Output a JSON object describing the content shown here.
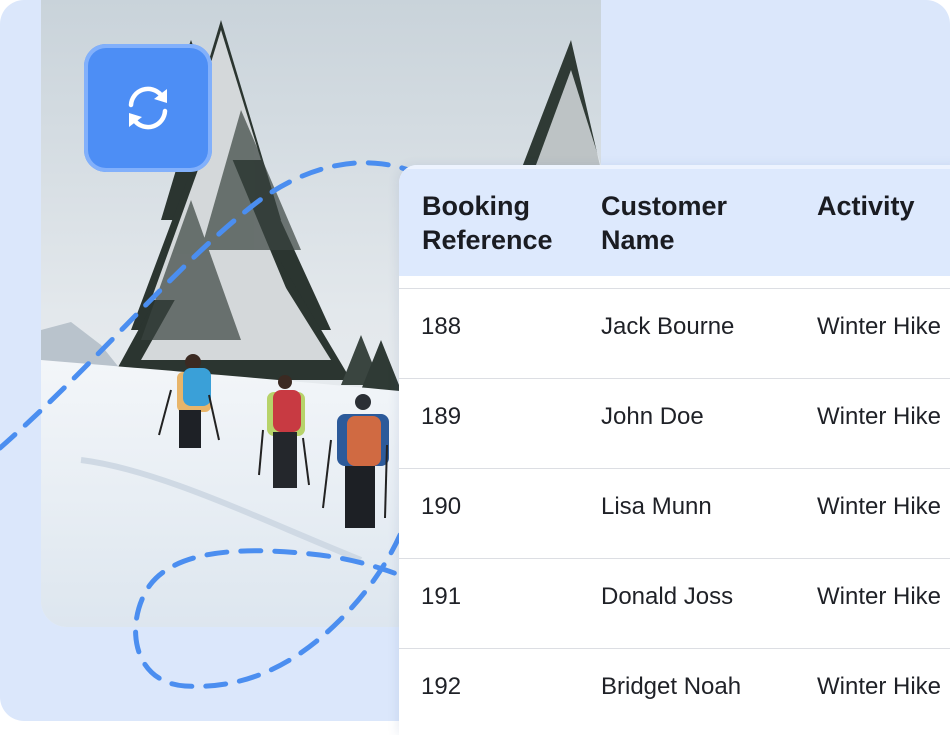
{
  "colors": {
    "accent": "#4d8ef5",
    "background": "#dbe7fb",
    "table_header_bg": "#dde9fd",
    "dashed_path": "#4b8ef0"
  },
  "photo": {
    "subject": "hikers-in-snowy-forest-image"
  },
  "sync_badge": {
    "icon": "sync-icon"
  },
  "table": {
    "headers": [
      {
        "line1": "Booking",
        "line2": "Reference"
      },
      {
        "line1": "Customer",
        "line2": "Name"
      },
      {
        "line1": "Activity",
        "line2": ""
      }
    ],
    "rows": [
      {
        "ref": "188",
        "name": "Jack Bourne",
        "activity": "Winter Hike"
      },
      {
        "ref": "189",
        "name": "John Doe",
        "activity": "Winter Hike"
      },
      {
        "ref": "190",
        "name": "Lisa Munn",
        "activity": "Winter Hike"
      },
      {
        "ref": "191",
        "name": "Donald Joss",
        "activity": "Winter Hike"
      },
      {
        "ref": "192",
        "name": "Bridget Noah",
        "activity": "Winter Hike"
      }
    ]
  }
}
